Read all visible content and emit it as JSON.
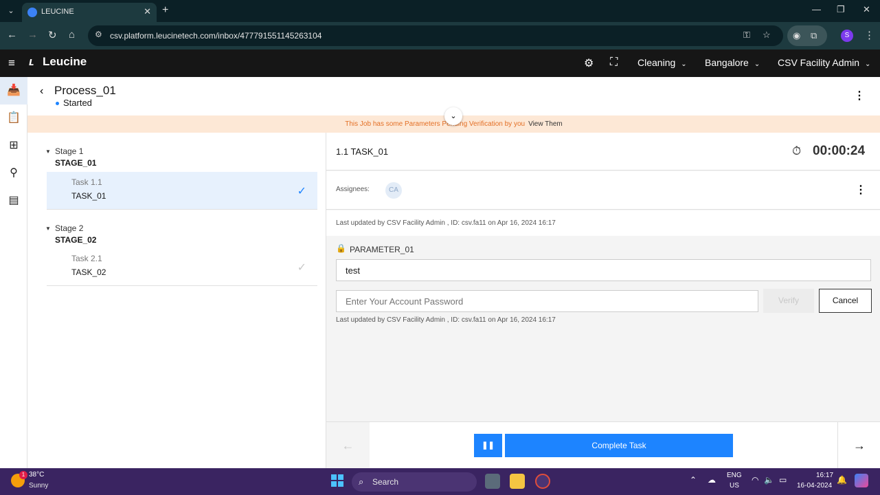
{
  "browser": {
    "tab_title": "LEUCINE",
    "tab_close": "✕",
    "new_tab": "+",
    "url": "csv.platform.leucinetech.com/inbox/477791551145263104",
    "profile_initial": "S"
  },
  "header": {
    "logo": "Leucine",
    "dropdowns": [
      {
        "label": "Cleaning"
      },
      {
        "label": "Bangalore"
      },
      {
        "label": "CSV Facility Admin"
      }
    ]
  },
  "job": {
    "title": "Process_01",
    "status": "Started",
    "banner_message": "This Job has some Parameters Pending Verification by you",
    "banner_link": "View Them"
  },
  "stages": [
    {
      "label": "Stage 1",
      "name": "STAGE_01",
      "tasks": [
        {
          "label": "Task 1.1",
          "name": "TASK_01",
          "selected": true
        }
      ]
    },
    {
      "label": "Stage 2",
      "name": "STAGE_02",
      "tasks": [
        {
          "label": "Task 2.1",
          "name": "TASK_02",
          "selected": false
        }
      ]
    }
  ],
  "task_panel": {
    "title": "1.1 TASK_01",
    "timer": "00:00:24",
    "assignees_label": "Assignees:",
    "assignee_initials": "CA",
    "last_updated": "Last updated by CSV Facility Admin , ID: csv.fa11 on Apr 16, 2024 16:17",
    "parameter_name": "PARAMETER_01",
    "parameter_value": "test",
    "password_placeholder": "Enter Your Account Password",
    "verify_label": "Verify",
    "cancel_label": "Cancel",
    "param_last_updated": "Last updated by CSV Facility Admin , ID: csv.fa11 on Apr 16, 2024 16:17",
    "complete_label": "Complete Task"
  },
  "colors": {
    "primary": "#1d84ff",
    "banner_bg": "#fde8d6",
    "banner_text": "#e36f25",
    "appbar": "#161616"
  },
  "taskbar": {
    "temperature": "38°C",
    "condition": "Sunny",
    "weather_badge": "1",
    "search_label": "Search",
    "lang": "ENG",
    "region": "US",
    "time": "16:17",
    "date": "16-04-2024"
  }
}
